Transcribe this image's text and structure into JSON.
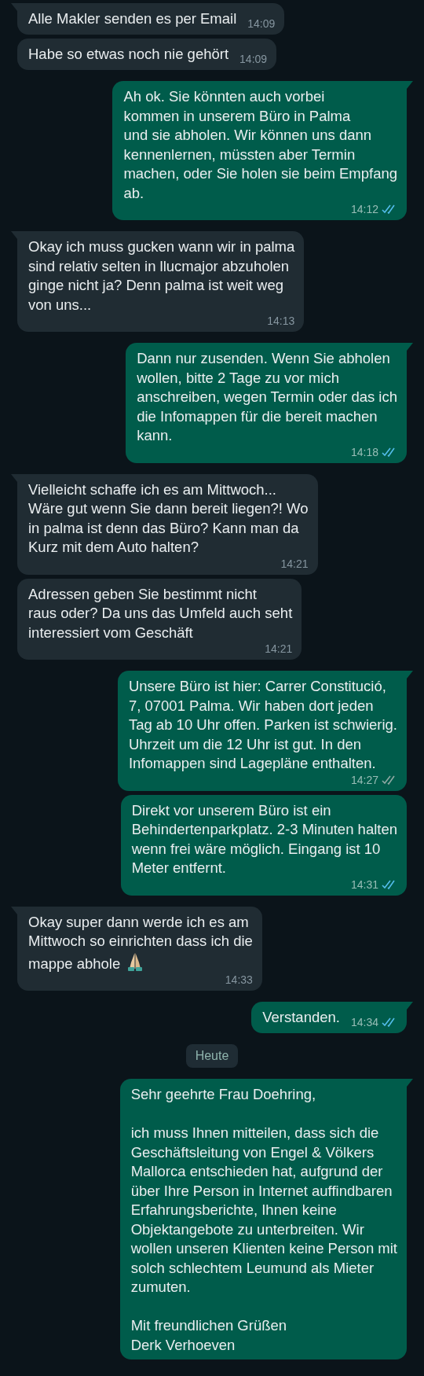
{
  "chat": [
    {
      "kind": "received",
      "text": "Alle Makler senden es per Email",
      "time": "14:09"
    },
    {
      "kind": "received",
      "text": "Habe so etwas noch nie gehört",
      "time": "14:09"
    },
    {
      "kind": "sent",
      "text": "Ah ok. Sie könnten auch vorbei\nkommen in unserem Büro in Palma\nund sie abholen. Wir können uns dann\nkennenlernen, müssten aber Termin\nmachen, oder Sie holen sie beim Empfang\nab.",
      "time": "14:12",
      "read": true
    },
    {
      "kind": "received",
      "text": "Okay ich muss gucken wann wir in palma\nsind relativ selten in llucmajor abzuholen\nginge nicht ja? Denn palma ist weit weg\nvon uns...",
      "time": "14:13"
    },
    {
      "kind": "sent",
      "text": "Dann nur zusenden. Wenn Sie abholen\nwollen, bitte 2 Tage zu vor mich\nanschreiben, wegen Termin oder das ich\ndie Infomappen für die bereit machen\nkann.",
      "time": "14:18",
      "read": true
    },
    {
      "kind": "received",
      "text": "Vielleicht schaffe ich es am Mittwoch...\nWäre gut wenn Sie dann bereit liegen?! Wo\nin palma ist denn das Büro? Kann man da\nKurz mit dem Auto halten?",
      "time": "14:21"
    },
    {
      "kind": "received",
      "text": "Adressen geben Sie bestimmt nicht\nraus oder? Da uns das Umfeld auch seht\ninteressiert vom Geschäft",
      "time": "14:21"
    },
    {
      "kind": "sent",
      "text": "Unsere Büro ist hier: Carrer Constitució,\n7, 07001 Palma. Wir haben dort jeden\nTag ab 10 Uhr offen. Parken ist schwierig.\nUhrzeit um die 12 Uhr ist gut. In den\nInfomappen sind Lagepläne enthalten.",
      "time": "14:27",
      "read": false
    },
    {
      "kind": "sent",
      "text": "Direkt vor unserem Büro ist ein\nBehindertenparkplatz. 2-3 Minuten halten\nwenn frei wäre möglich. Eingang ist 10\nMeter entfernt.",
      "time": "14:31",
      "read": true
    },
    {
      "kind": "received",
      "text": "Okay super dann werde ich es am\nMittwoch so einrichten dass ich die\nmappe abhole",
      "time": "14:33",
      "emoji": true
    },
    {
      "kind": "sent",
      "text": "Verstanden.",
      "time": "14:34",
      "read": true
    },
    {
      "kind": "date",
      "text": "Heute"
    },
    {
      "kind": "sent",
      "text": "Sehr geehrte Frau Doehring,\n\nich muss Ihnen mitteilen, dass sich die\nGeschäftsleitung von Engel & Völkers\nMallorca entschieden hat, aufgrund der\nüber Ihre Person in Internet auffindbaren\nErfahrungsberichte, Ihnen keine\nObjektangebote zu unterbreiten. Wir\nwollen unseren Klienten keine Person mit\nsolch schlechtem Leumund als Mieter\nzumuten.\n\nMit freundlichen Grüßen\nDerk Verhoeven"
    }
  ]
}
